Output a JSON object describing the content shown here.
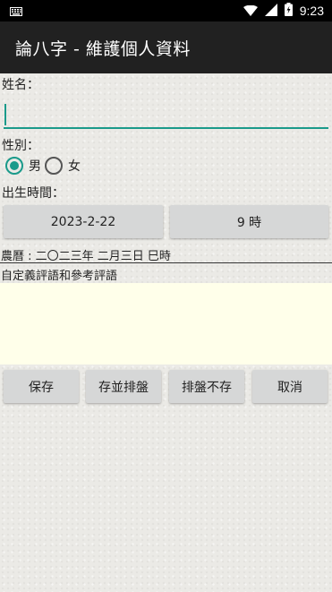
{
  "status_bar": {
    "time": "9:23"
  },
  "app_bar": {
    "title": "論八字 - 維護個人資料"
  },
  "form": {
    "name_label": "姓名：",
    "name_value": "",
    "gender_label": "性別：",
    "gender_options": [
      {
        "label": "男",
        "checked": true
      },
      {
        "label": "女",
        "checked": false
      }
    ],
    "birth_label": "出生時間：",
    "date_button": "2023-2-22",
    "hour_button": "9 時",
    "lunar_text": "農曆 : 二〇二三年 二月三日 巳時",
    "comment_label": "自定義評語和參考評語",
    "comment_value": ""
  },
  "actions": {
    "save": "保存",
    "save_and_chart": "存並排盤",
    "chart_no_save": "排盤不存",
    "cancel": "取消"
  },
  "colors": {
    "accent": "#1a9a8a",
    "app_bar": "#212121",
    "comment_bg": "#ffffea"
  }
}
